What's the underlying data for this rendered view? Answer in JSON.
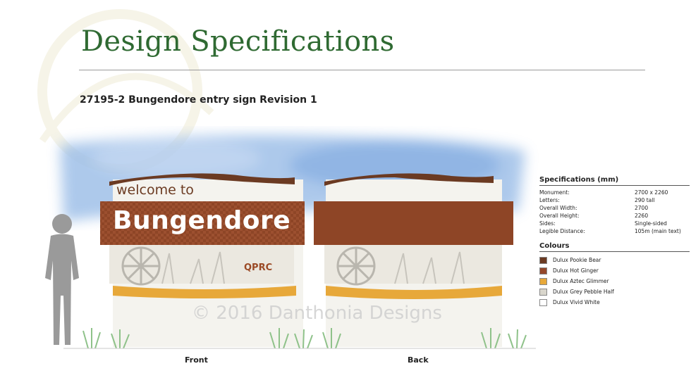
{
  "header": {
    "title": "Design Specifications",
    "subtitle": "27195-2 Bungendore entry sign Revision 1"
  },
  "sign": {
    "welcome_text": "welcome to",
    "town_name": "Bungendore",
    "logo_text": "QPRC",
    "watermark": "© 2016 Danthonia Designs"
  },
  "captions": {
    "front": "Front",
    "back": "Back"
  },
  "specifications": {
    "heading": "Specifications (mm)",
    "rows": [
      {
        "label": "Monument:",
        "value": "2700 x 2260"
      },
      {
        "label": "Letters:",
        "value": "290 tall"
      },
      {
        "label": "Overall Width:",
        "value": "2700"
      },
      {
        "label": "Overall Height:",
        "value": "2260"
      },
      {
        "label": "Sides:",
        "value": "Single-sided"
      },
      {
        "label": "Legible Distance:",
        "value": "105m (main text)"
      }
    ]
  },
  "colours": {
    "heading": "Colours",
    "items": [
      {
        "name": "Dulux Pookie Bear",
        "color": "#6b3a22"
      },
      {
        "name": "Dulux Hot Ginger",
        "color": "#94472a"
      },
      {
        "name": "Dulux Aztec Glimmer",
        "color": "#e7a83a"
      },
      {
        "name": "Dulux Grey Pebble Half",
        "color": "#d9d6cc"
      },
      {
        "name": "Dulux Vivid White",
        "color": "#ffffff"
      }
    ]
  }
}
